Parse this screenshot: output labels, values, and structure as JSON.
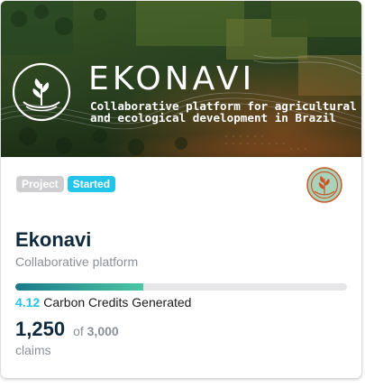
{
  "banner": {
    "brand_name": "EKONAVI",
    "tagline_line1": "Collaborative platform for agricultural",
    "tagline_line2": "and ecological development in Brazil"
  },
  "badges": [
    {
      "label": "Project",
      "color": "#cfcfd1"
    },
    {
      "label": "Started",
      "color": "#22c4ea"
    }
  ],
  "project": {
    "title": "Ekonavi",
    "subtitle": "Collaborative platform"
  },
  "progress": {
    "fraction": 0.385,
    "credits_value": "4.12",
    "credits_label": "Carbon Credits Generated"
  },
  "claims": {
    "count": "1,250",
    "of_label": "of",
    "total": "3,000",
    "label": "claims"
  },
  "colors": {
    "accent": "#22c4ea",
    "title": "#0f2a3d",
    "muted": "#8a8f99",
    "avatar_bg": "#a9d2b9",
    "avatar_ring": "#c9582b"
  }
}
